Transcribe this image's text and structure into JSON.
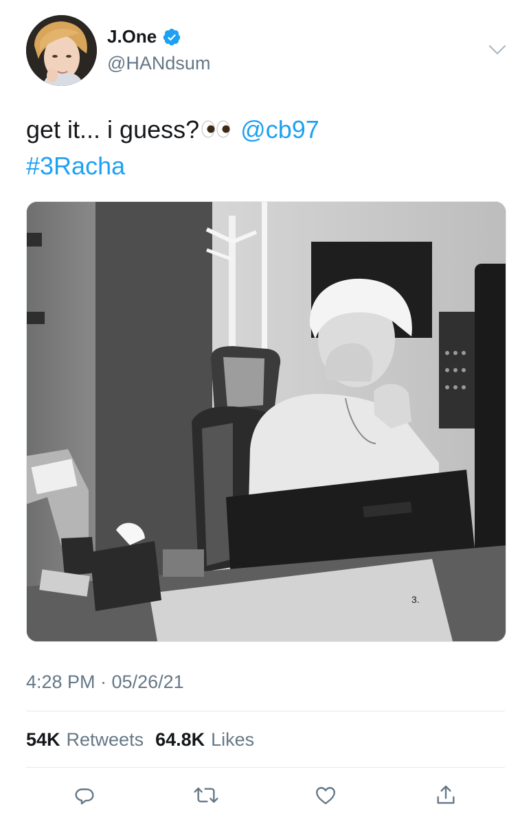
{
  "user": {
    "display_name": "J.One",
    "handle": "@HANdsum",
    "verified": true
  },
  "tweet": {
    "text_prefix": "get it... i guess?",
    "emoji_name": "eyes-emoji",
    "mention": "@cb97",
    "hashtag": "#3Racha",
    "image_description_icons": [
      "photo"
    ],
    "image_corner_mark": "3.",
    "timestamp": "4:28 PM · 05/26/21"
  },
  "stats": {
    "retweets_count": "54K",
    "retweets_label": "Retweets",
    "likes_count": "64.8K",
    "likes_label": "Likes"
  },
  "actions": [
    {
      "name": "reply-icon"
    },
    {
      "name": "retweet-icon"
    },
    {
      "name": "like-icon"
    },
    {
      "name": "share-icon"
    }
  ],
  "colors": {
    "link": "#1da1f2",
    "secondary_text": "#657786",
    "primary_text": "#14171a",
    "divider": "#e1e8ed"
  }
}
